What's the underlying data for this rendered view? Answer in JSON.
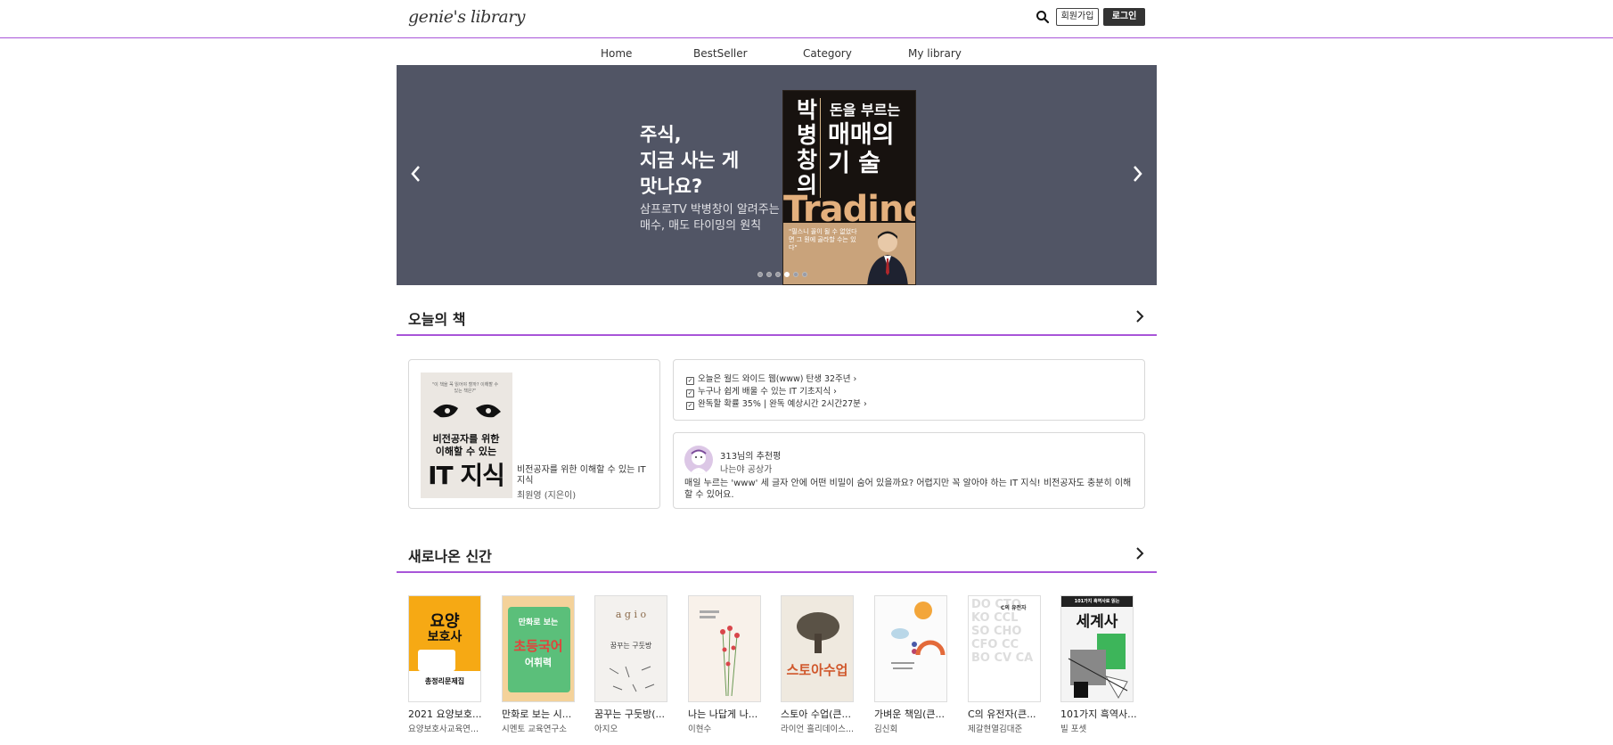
{
  "header": {
    "logo": "genie's library",
    "join_label": "회원가입",
    "login_label": "로그인"
  },
  "nav": [
    "Home",
    "BestSeller",
    "Category",
    "My library"
  ],
  "banner": {
    "headline": [
      "주식,",
      "지금 사는 게",
      "맛나요?"
    ],
    "subtext": [
      "삼프로TV 박병창이 알려주는",
      "매수, 매도 타이밍의 원칙"
    ],
    "book": {
      "author_col": [
        "박",
        "병",
        "창",
        "의"
      ],
      "top": "돈을 부르는",
      "big": [
        "매매의",
        "기   술"
      ],
      "trading": "Trading",
      "blurb": "\"필스니 꼴이 될 수 없었다면 그 뭔에 골라할 수는 있다\""
    },
    "slides_count": 6,
    "active_slide": 4
  },
  "today": {
    "section_title": "오늘의 책",
    "book_title": "비전공자를 위한 이해할 수 있는 IT지식",
    "book_author": "최원영 (지은이)",
    "cover": {
      "small": "\"이 책을 꼭 읽어야 할까? 이해할 수 있는 책은?\"",
      "line1": "비전공자를 위한",
      "line2": "이해할 수 있는",
      "line3": "IT 지식"
    },
    "info_lines": [
      "오늘은 월드 와이드 웹(www) 탄생 32주년",
      "누구나 쉽게 배울 수 있는 IT 기초지식",
      "완독할 확률 35% | 완독 예상시간 2시간27분"
    ],
    "recommend": {
      "count": "313님의 추천평",
      "sub": "나는야 공상가",
      "body": "매일 누르는 'www' 세 글자 안에 어떤 비밀이 숨어 있을까요? 어렵지만 꼭 알아야 하는 IT 지식! 비전공자도 충분히 이해할 수 있어요."
    }
  },
  "new_books": {
    "section_title": "새로나온 신간",
    "items": [
      {
        "title": "2021 요양보호...",
        "author": "요양보호사교육연..."
      },
      {
        "title": "만화로 보는 시...",
        "author": "시멘토 교육연구소"
      },
      {
        "title": "꿈꾸는 구둣방(...",
        "author": "아지오"
      },
      {
        "title": "나는 나답게 나...",
        "author": "이현수"
      },
      {
        "title": "스토아 수업(큰...",
        "author": "라이언 흘리데이스..."
      },
      {
        "title": "가벼운 책임(큰...",
        "author": "김신회"
      },
      {
        "title": "C의 유전자(큰...",
        "author": "제갈현열김대준"
      },
      {
        "title": "101가지 흑역사...",
        "author": "빌 포셋"
      }
    ],
    "covers": {
      "c1_a": "요양",
      "c1_b": "보호사",
      "c1_c": "총정리문제집",
      "c2_a": "만화로 보는",
      "c2_b": "초등국어",
      "c2_c": "어휘력",
      "c3_a": "a g i o",
      "c3_b": "꿈꾸는 구둣방",
      "c5": "스토아수업",
      "c7": [
        "DO",
        "CTO",
        "KO",
        "CCL",
        "SO",
        "CHO",
        "CFO",
        "CC",
        "BO",
        "CV",
        "CA",
        "C의 유전자"
      ],
      "c8_a": "101가지 흑역사로 읽는",
      "c8_b": "세계사"
    }
  }
}
